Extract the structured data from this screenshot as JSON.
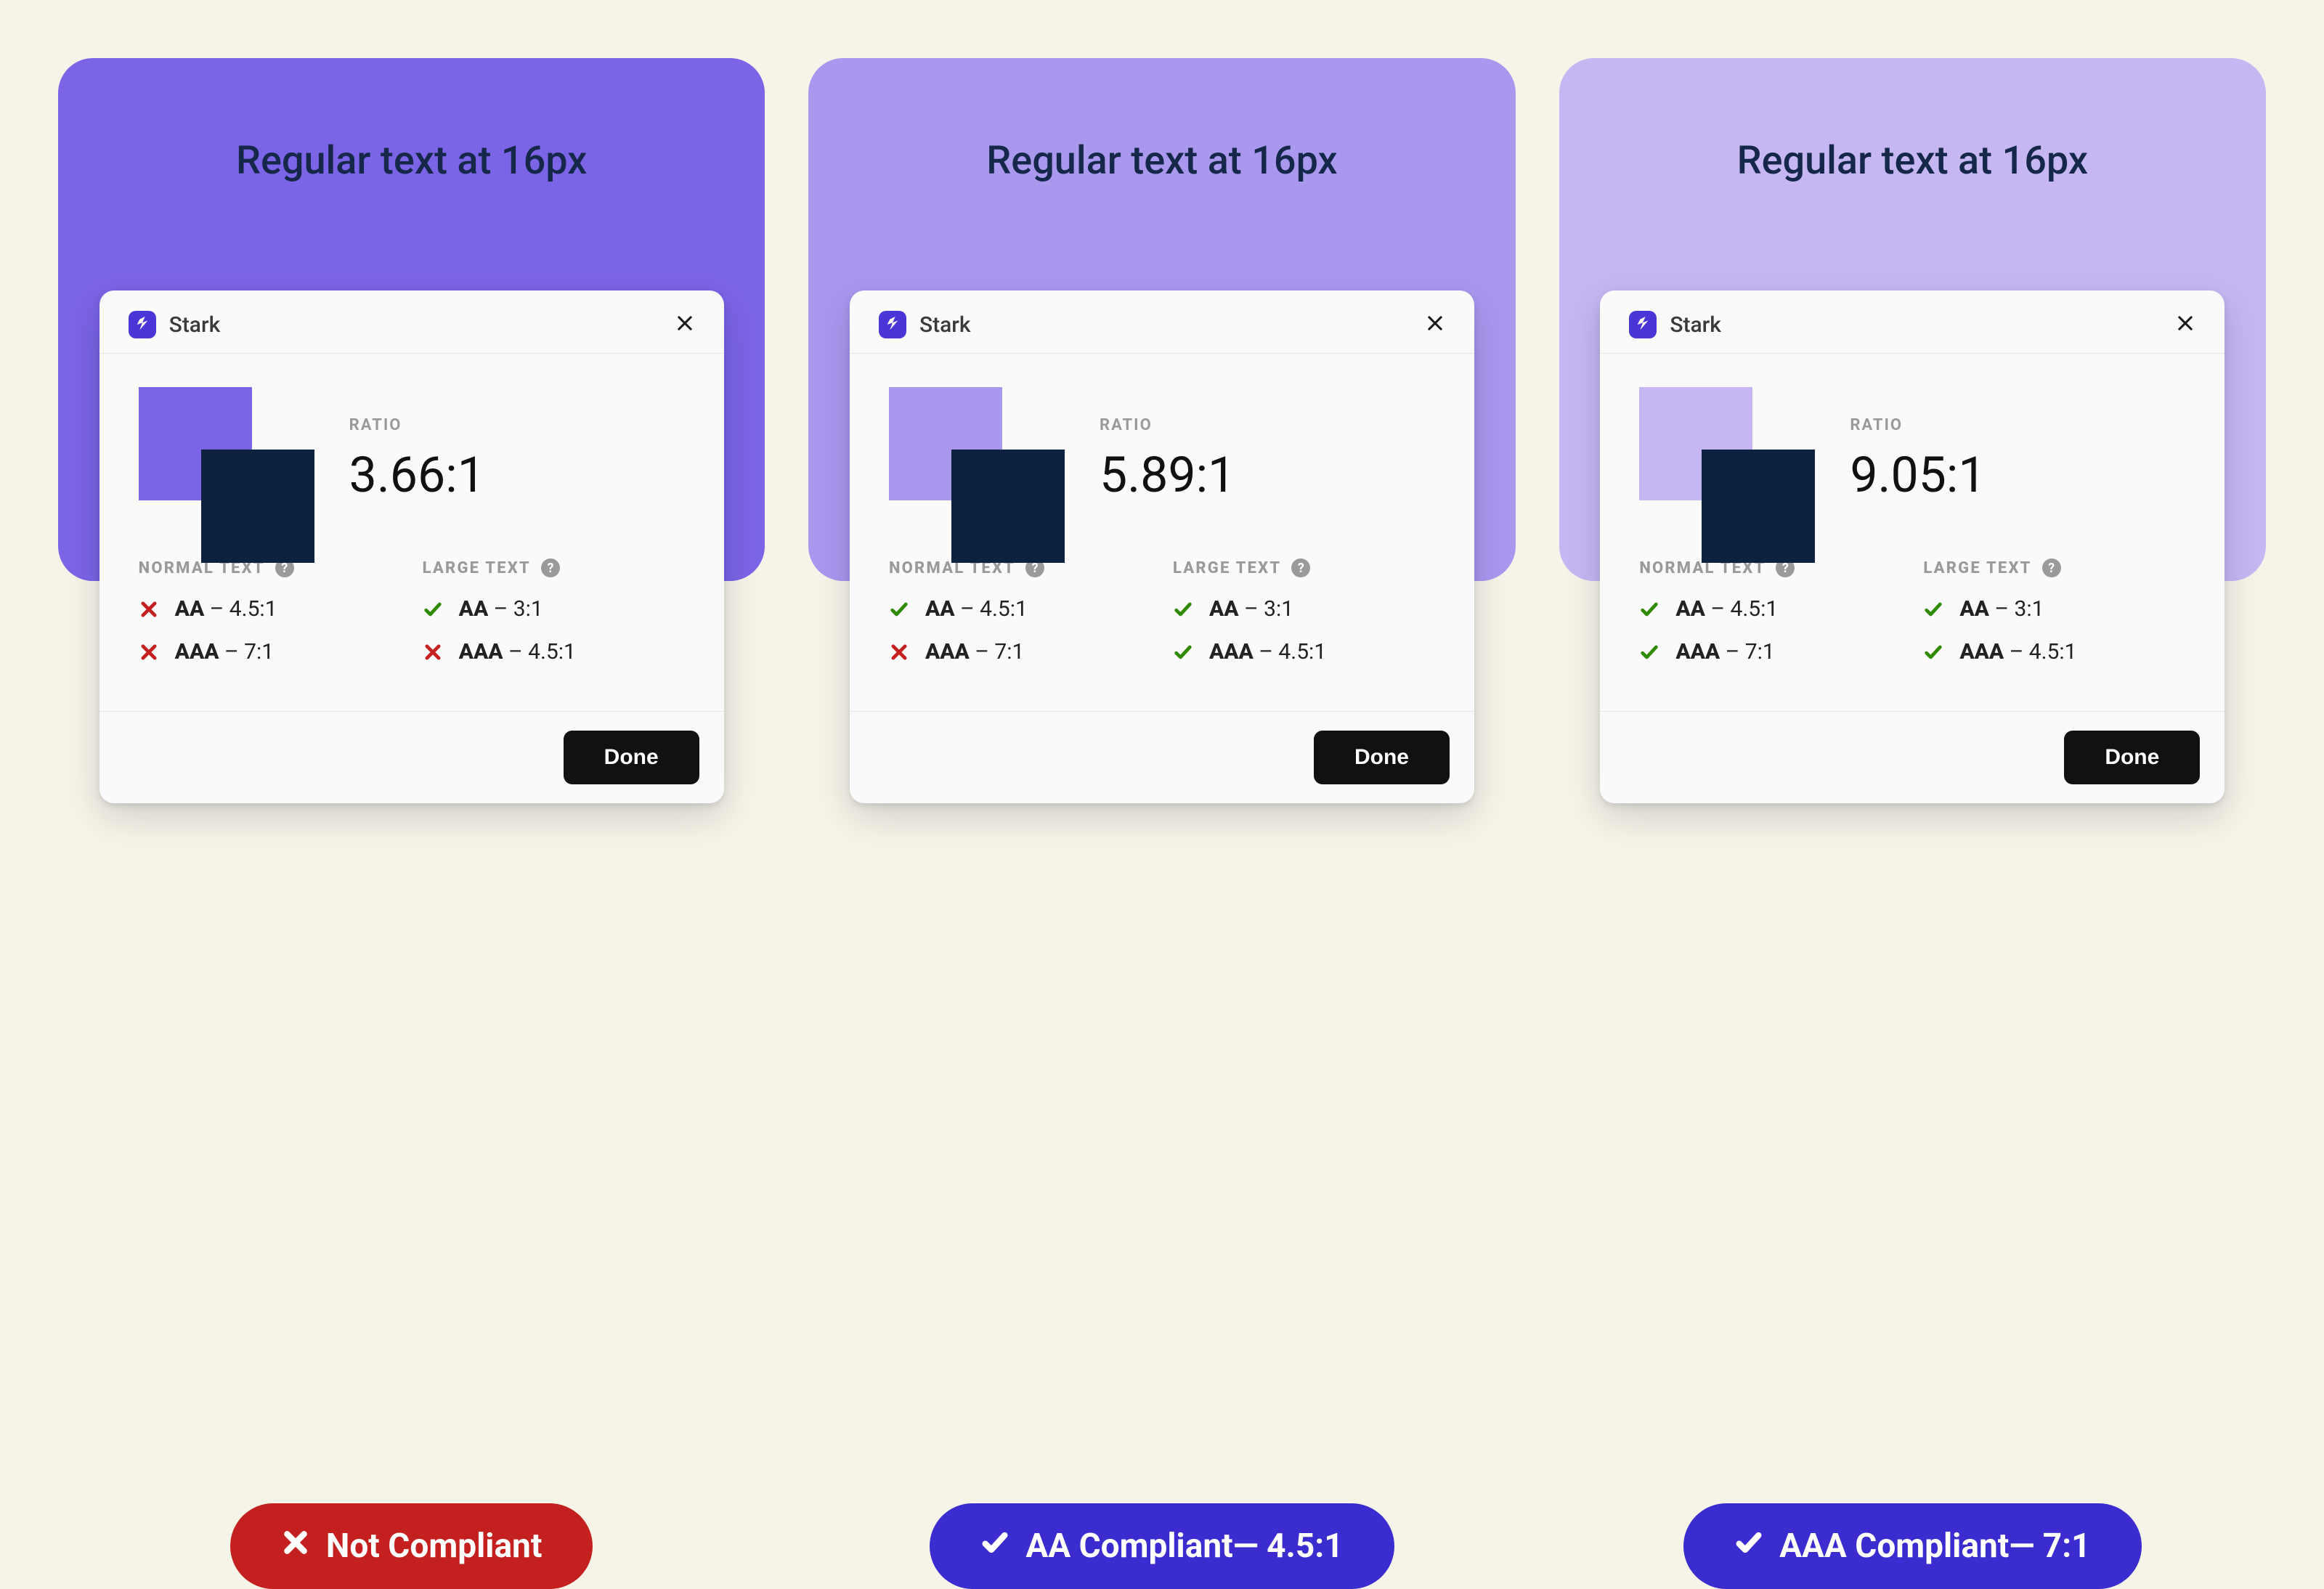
{
  "shared": {
    "hero_text": "Regular text at 16px",
    "panel_title": "Stark",
    "ratio_label": "RATIO",
    "normal_text_label": "NORMAL TEXT",
    "large_text_label": "LARGE TEXT",
    "done_label": "Done",
    "normal_aa": "AA – 4.5:1",
    "normal_aaa": "AAA – 7:1",
    "large_aa": "AA – 3:1",
    "large_aaa": "AAA – 4.5:1"
  },
  "cards": [
    {
      "bg": "#7c64e6",
      "swatch_bg": "#7c64e6",
      "ratio": "3.66:1",
      "normal_aa_pass": false,
      "normal_aaa_pass": false,
      "large_aa_pass": true,
      "large_aaa_pass": false,
      "pill_bg": "red",
      "pill_icon": "x",
      "pill_text": "Not Compliant"
    },
    {
      "bg": "#aa98ef",
      "swatch_bg": "#aa98ef",
      "ratio": "5.89:1",
      "normal_aa_pass": true,
      "normal_aaa_pass": false,
      "large_aa_pass": true,
      "large_aaa_pass": true,
      "pill_bg": "blue",
      "pill_icon": "check",
      "pill_text": "AA Compliant— 4.5:1"
    },
    {
      "bg": "#c6b7f3",
      "swatch_bg": "#c6b7f3",
      "ratio": "9.05:1",
      "normal_aa_pass": true,
      "normal_aaa_pass": true,
      "large_aa_pass": true,
      "large_aaa_pass": true,
      "pill_bg": "blue",
      "pill_icon": "check",
      "pill_text": "AAA Compliant— 7:1"
    }
  ]
}
